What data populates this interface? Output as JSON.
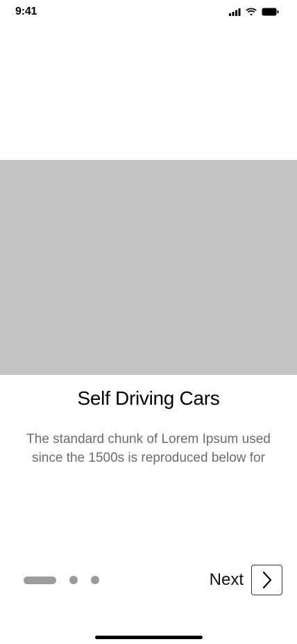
{
  "status_bar": {
    "time": "9:41",
    "icons": [
      "cellular-signal-icon",
      "wifi-icon",
      "battery-icon"
    ]
  },
  "hero": {
    "placeholder_color": "#c4c4c4"
  },
  "content": {
    "title": "Self Driving Cars",
    "description": "The standard chunk of Lorem Ipsum used since the 1500s is reproduced below for"
  },
  "pager": {
    "total": 3,
    "active_index": 0,
    "color": "#9b9b9b"
  },
  "navigation": {
    "next_label": "Next",
    "next_icon": "chevron-right-icon"
  }
}
